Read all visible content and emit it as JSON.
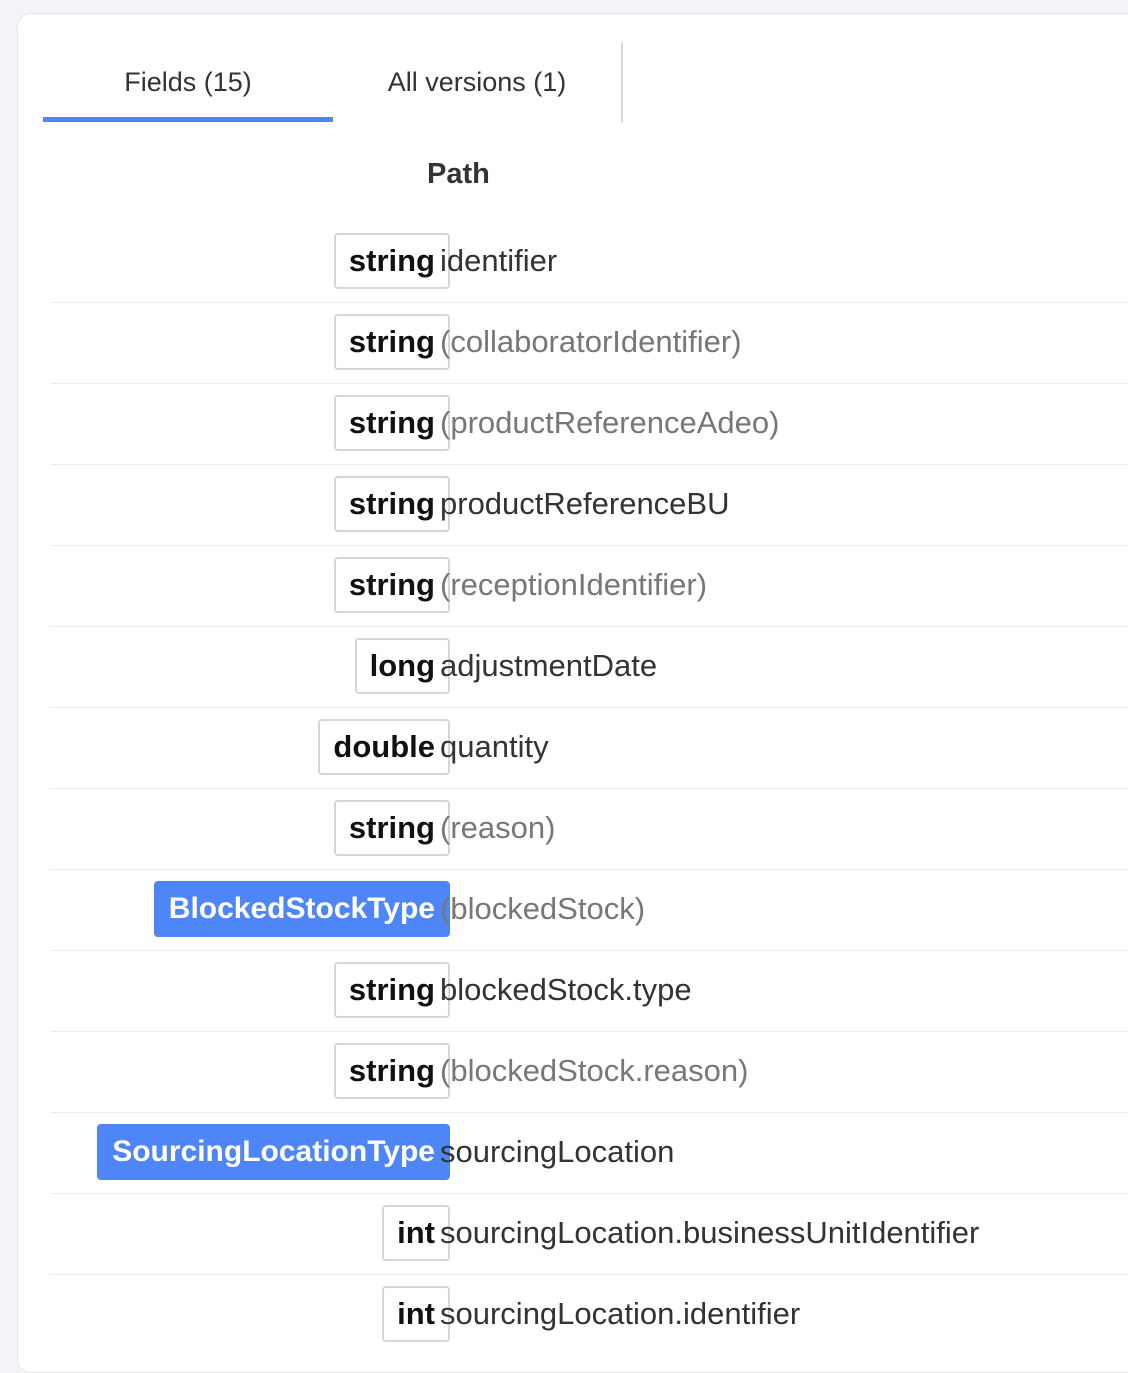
{
  "tabs": [
    {
      "label": "Fields (15)",
      "active": true
    },
    {
      "label": "All versions (1)",
      "active": false
    }
  ],
  "table": {
    "path_header": "Path",
    "rows": [
      {
        "type": "string",
        "name": "identifier",
        "optional": false,
        "complex": false
      },
      {
        "type": "string",
        "name": "(collaboratorIdentifier)",
        "optional": true,
        "complex": false
      },
      {
        "type": "string",
        "name": "(productReferenceAdeo)",
        "optional": true,
        "complex": false
      },
      {
        "type": "string",
        "name": "productReferenceBU",
        "optional": false,
        "complex": false
      },
      {
        "type": "string",
        "name": "(receptionIdentifier)",
        "optional": true,
        "complex": false
      },
      {
        "type": "long",
        "name": "adjustmentDate",
        "optional": false,
        "complex": false
      },
      {
        "type": "double",
        "name": "quantity",
        "optional": false,
        "complex": false
      },
      {
        "type": "string",
        "name": "(reason)",
        "optional": true,
        "complex": false
      },
      {
        "type": "BlockedStockType",
        "name": "(blockedStock)",
        "optional": true,
        "complex": true
      },
      {
        "type": "string",
        "name": "blockedStock.type",
        "optional": false,
        "complex": false
      },
      {
        "type": "string",
        "name": "(blockedStock.reason)",
        "optional": true,
        "complex": false
      },
      {
        "type": "SourcingLocationType",
        "name": "sourcingLocation",
        "optional": false,
        "complex": true
      },
      {
        "type": "int",
        "name": "sourcingLocation.businessUnitIdentifier",
        "optional": false,
        "complex": false
      },
      {
        "type": "int",
        "name": "sourcingLocation.identifier",
        "optional": false,
        "complex": false
      }
    ]
  },
  "colors": {
    "accent": "#4f86f7",
    "badge_border": "#d6d6d6",
    "optional_text": "#777777",
    "text": "#333333"
  }
}
